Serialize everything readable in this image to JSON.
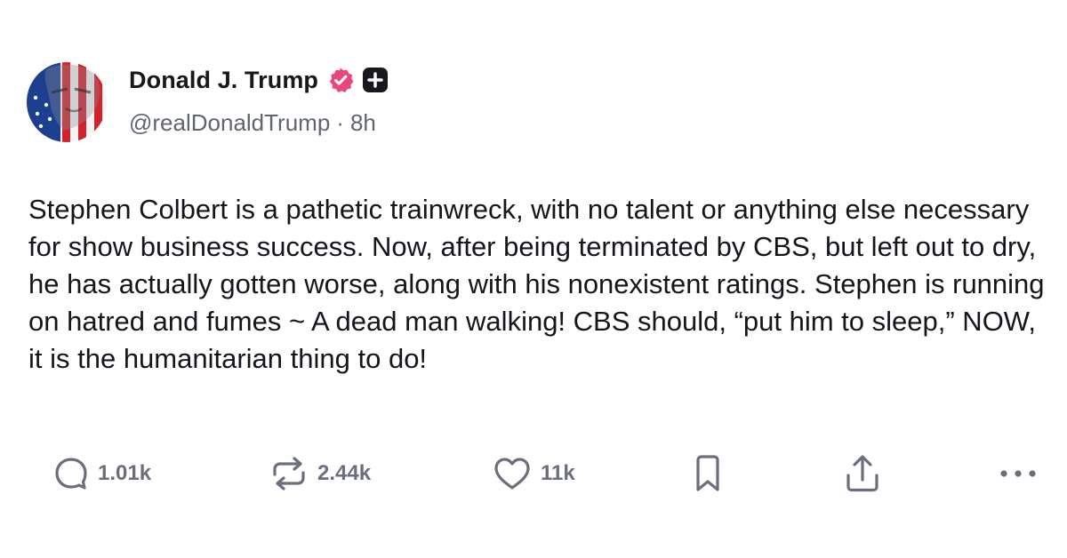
{
  "author": {
    "display_name": "Donald J. Trump",
    "handle": "@realDonaldTrump",
    "time_ago": "8h",
    "separator": "·",
    "badges": [
      "verified-badge",
      "plus-badge"
    ]
  },
  "post": {
    "text": "Stephen Colbert is a pathetic trainwreck, with no talent or anything else necessary for show business success. Now, after being terminated by CBS, but left out to dry, he has actually gotten worse, along with his nonexistent ratings. Stephen is running on hatred and fumes ~ A dead man walking! CBS should, “put him to sleep,” NOW, it is the humanitarian thing to do!"
  },
  "actions": {
    "reply": {
      "icon": "reply-icon",
      "count": "1.01k"
    },
    "retruth": {
      "icon": "retruth-icon",
      "count": "2.44k"
    },
    "like": {
      "icon": "heart-icon",
      "count": "11k"
    },
    "bookmark": {
      "icon": "bookmark-icon"
    },
    "share": {
      "icon": "share-icon"
    },
    "more": {
      "icon": "more-icon"
    }
  },
  "colors": {
    "text": "#15151b",
    "muted": "#5f6472",
    "action_gray": "#6b6e7d",
    "verified_pink": "#e8467c",
    "badge_dark": "#18181f"
  }
}
